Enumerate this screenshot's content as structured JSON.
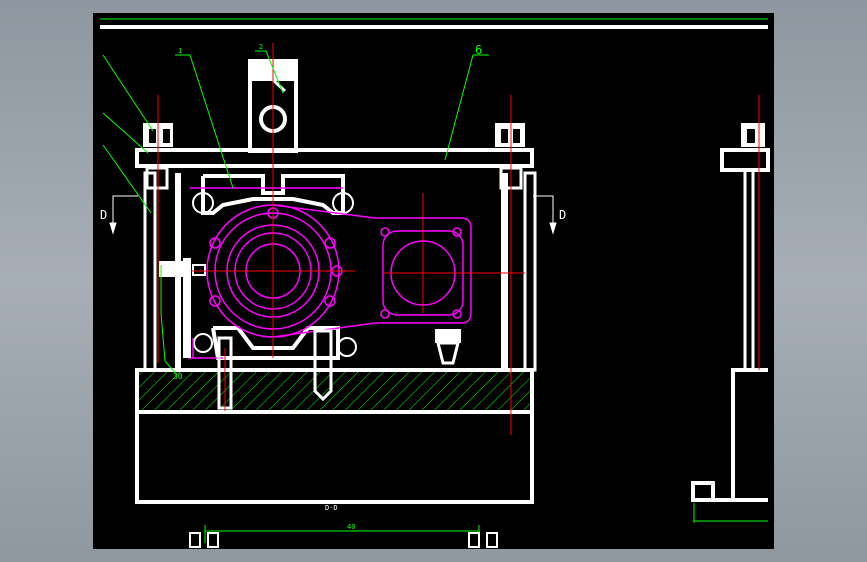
{
  "drawing": {
    "section_marks": {
      "left": "D",
      "right": "D"
    },
    "section_title": "D-D",
    "leader_labels": [
      "1",
      "2",
      "6"
    ],
    "dimension_text": "40",
    "colors": {
      "background": "#000000",
      "geometry": "#ffffff",
      "leader": "#00ff00",
      "part_outline": "#ff00ff",
      "centerline": "#ff0000",
      "frame_bg": "#9aa2a9"
    }
  }
}
